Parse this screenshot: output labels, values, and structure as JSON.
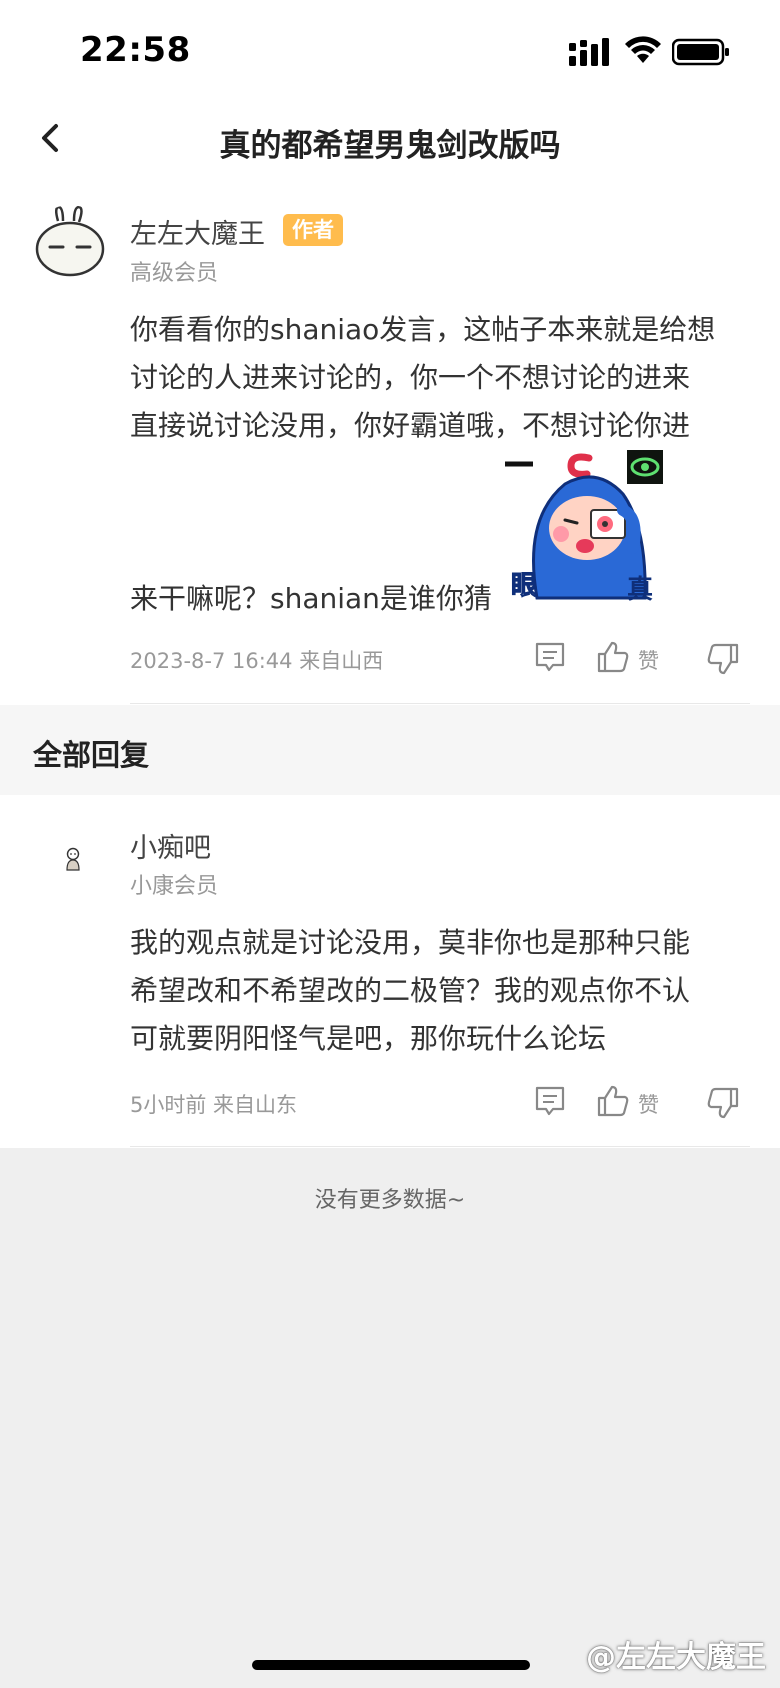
{
  "status_bar": {
    "time": "22:58"
  },
  "nav": {
    "title": "真的都希望男鬼剑改版吗"
  },
  "post": {
    "author": "左左大魔王",
    "author_badge": "作者",
    "author_level": "高级会员",
    "text_lines": [
      "你看看你的shaniao发言，这帖子本来就是给想",
      "讨论的人进来讨论的，你一个不想讨论的进来",
      "直接说讨论没用，你好霸道哦，不想讨论你进",
      "来干嘛呢？shanian是谁你猜"
    ],
    "sticker": {
      "left_text": "眼",
      "right_text": "真",
      "icon": "eye-sticker-icon"
    },
    "meta": "2023-8-7 16:44  来自山西",
    "like_label": "赞"
  },
  "section": {
    "title": "全部回复"
  },
  "reply": {
    "author": "小痴吧",
    "author_level": "小康会员",
    "text_lines": [
      "我的观点就是讨论没用，莫非你也是那种只能",
      "希望改和不希望改的二极管？我的观点你不认",
      "可就要阴阳怪气是吧，那你玩什么论坛"
    ],
    "meta": "5小时前 来自山东",
    "like_label": "赞"
  },
  "footer": {
    "no_more": "没有更多数据~"
  },
  "watermark": "@左左大魔王",
  "colors": {
    "badge": "#ffbc4d",
    "text": "#333333",
    "meta": "#999999",
    "background": "#efefef"
  }
}
